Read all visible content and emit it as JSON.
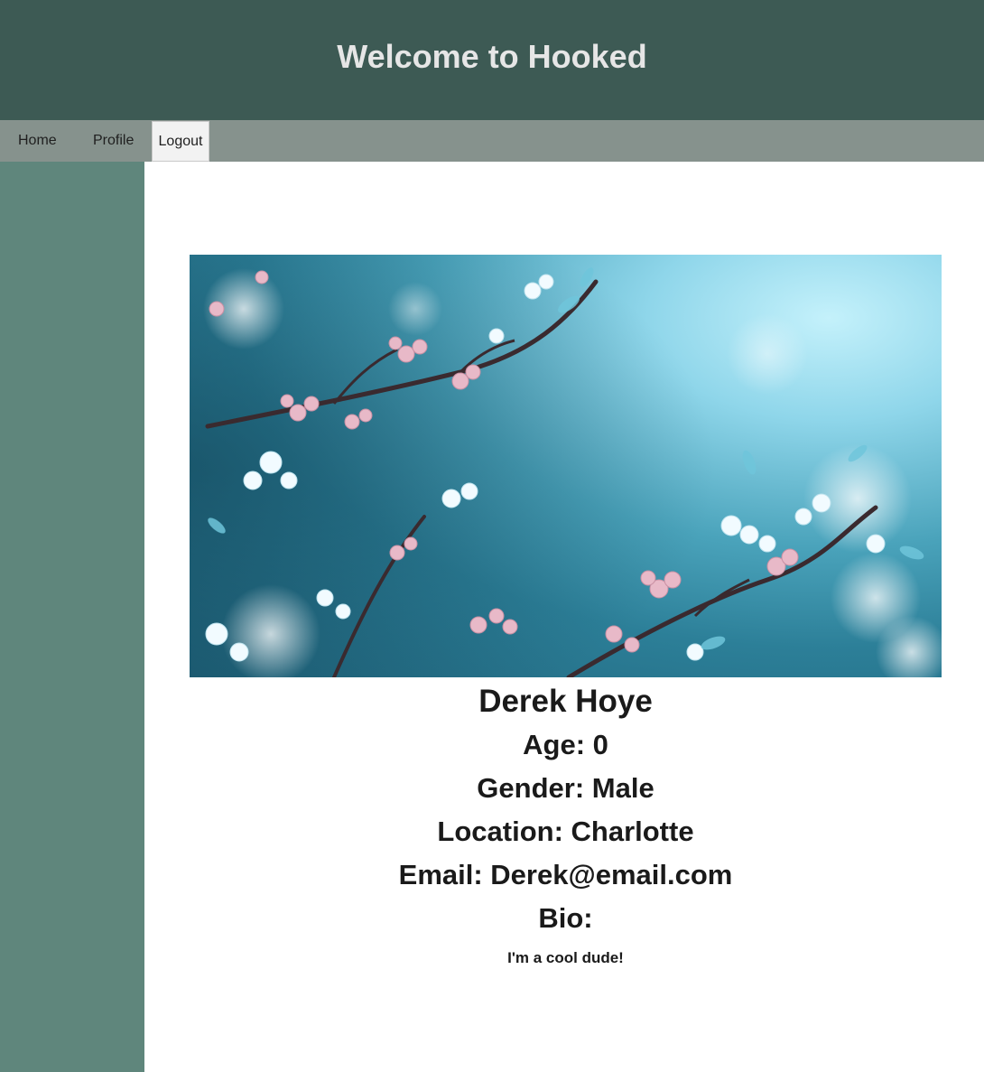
{
  "header": {
    "title": "Welcome to Hooked"
  },
  "nav": {
    "home_label": "Home",
    "profile_label": "Profile",
    "logout_label": "Logout"
  },
  "profile": {
    "name": "Derek Hoye",
    "age_line": "Age: 0",
    "gender_line": "Gender: Male",
    "location_line": "Location: Charlotte",
    "email_line": "Email: Derek@email.com",
    "bio_label": "Bio:",
    "bio_text": "I'm a cool dude!"
  },
  "colors": {
    "header_bg": "#3d5a54",
    "nav_bg": "#86928d",
    "sidebar_bg": "#5f867c",
    "content_bg": "#ffffff"
  },
  "icons": {
    "profile_photo": "cherry-blossom-photo"
  }
}
